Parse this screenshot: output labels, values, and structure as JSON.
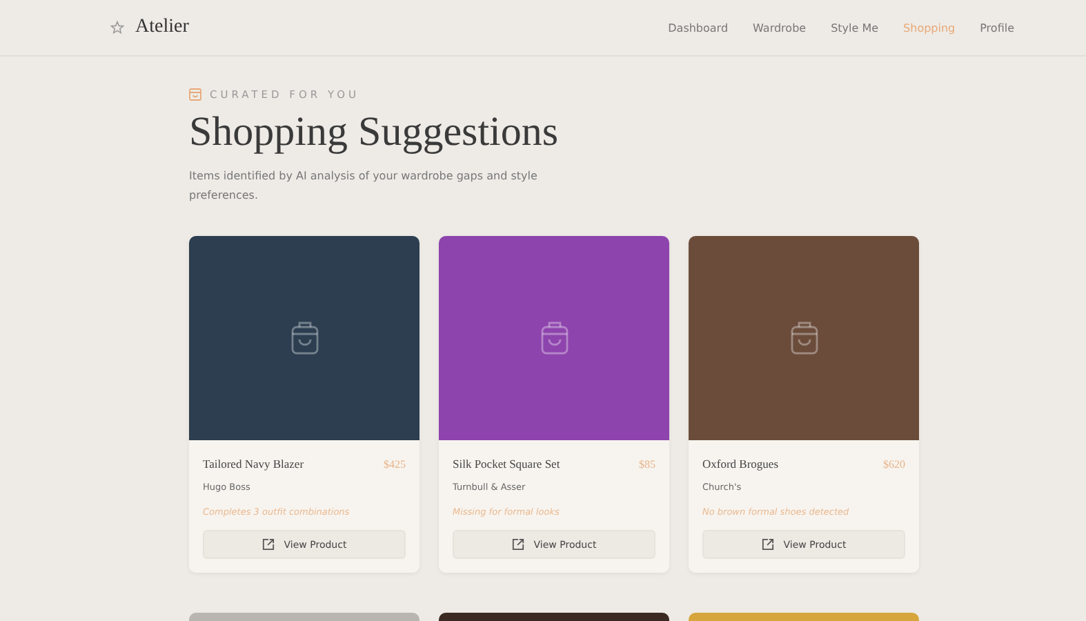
{
  "brand": "Atelier",
  "nav": [
    {
      "label": "Dashboard",
      "selected": false
    },
    {
      "label": "Wardrobe",
      "selected": false
    },
    {
      "label": "Style Me",
      "selected": false
    },
    {
      "label": "Shopping",
      "selected": true
    },
    {
      "label": "Profile",
      "selected": false
    }
  ],
  "eyebrow": "CURATED FOR YOU",
  "title": "Shopping Suggestions",
  "subtitle": "Items identified by AI analysis of your wardrobe gaps and style preferences.",
  "products": [
    {
      "color": "#2c3e50",
      "name": "Tailored Navy Blazer",
      "price": "$425",
      "brand": "Hugo Boss",
      "reason": "Completes 3 outfit combinations",
      "button": "View Product"
    },
    {
      "color": "#8e44ad",
      "name": "Silk Pocket Square Set",
      "price": "$85",
      "brand": "Turnbull & Asser",
      "reason": "Missing for formal looks",
      "button": "View Product"
    },
    {
      "color": "#6b4c3b",
      "name": "Oxford Brogues",
      "price": "$620",
      "brand": "Church's",
      "reason": "No brown formal shoes detected",
      "button": "View Product"
    }
  ],
  "next_row": [
    {
      "color": "#b9b6b1"
    },
    {
      "color": "#3b2a22"
    },
    {
      "color": "#d6a63c"
    }
  ]
}
